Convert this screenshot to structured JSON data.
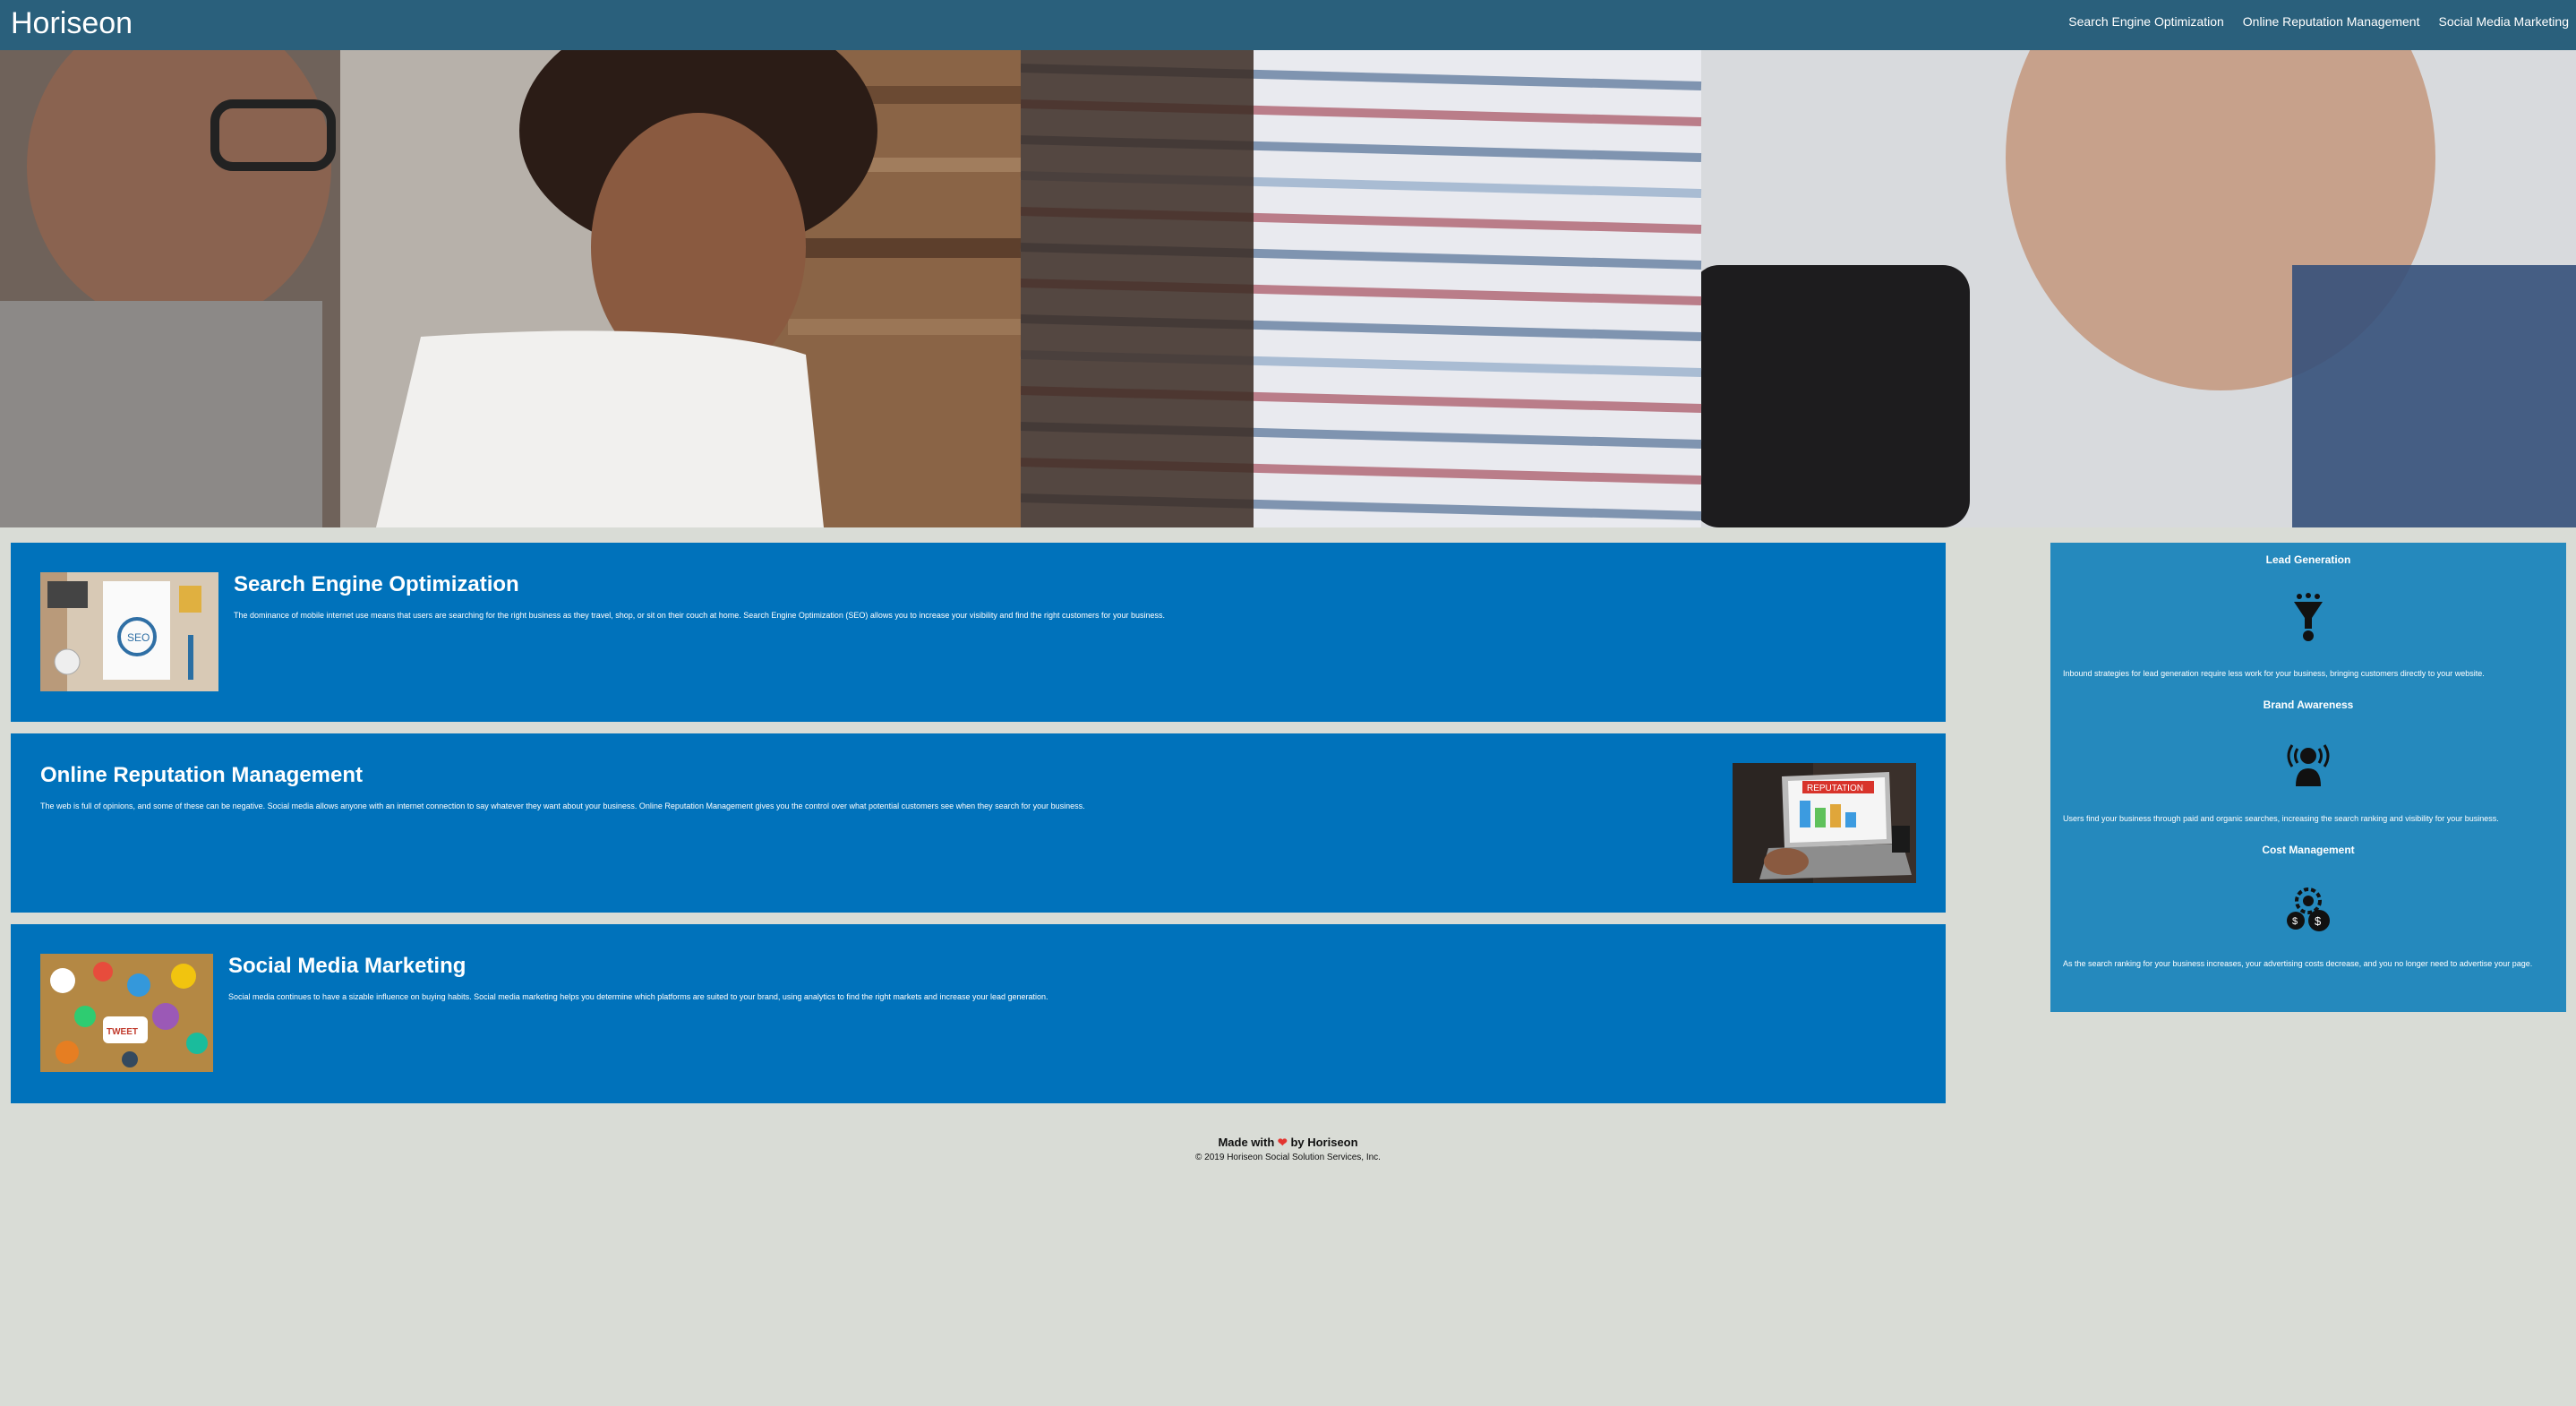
{
  "header": {
    "logo": "Horiseon",
    "nav": [
      {
        "label": "Search Engine Optimization"
      },
      {
        "label": "Online Reputation Management"
      },
      {
        "label": "Social Media Marketing"
      }
    ]
  },
  "content": {
    "cards": [
      {
        "title": "Search Engine Optimization",
        "text": "The dominance of mobile internet use means that users are searching for the right business as they travel, shop, or sit on their couch at home. Search Engine Optimization (SEO) allows you to increase your visibility and find the right customers for your business."
      },
      {
        "title": "Online Reputation Management",
        "text": "The web is full of opinions, and some of these can be negative. Social media allows anyone with an internet connection to say whatever they want about your business. Online Reputation Management gives you the control over what potential customers see when they search for your business."
      },
      {
        "title": "Social Media Marketing",
        "text": "Social media continues to have a sizable influence on buying habits. Social media marketing helps you determine which platforms are suited to your brand, using analytics to find the right markets and increase your lead generation."
      }
    ]
  },
  "sidebar": {
    "items": [
      {
        "title": "Lead Generation",
        "text": "Inbound strategies for lead generation require less work for your business, bringing customers directly to your website."
      },
      {
        "title": "Brand Awareness",
        "text": "Users find your business through paid and organic searches, increasing the search ranking and visibility for your business."
      },
      {
        "title": "Cost Management",
        "text": "As the search ranking for your business increases, your advertising costs decrease, and you no longer need to advertise your page."
      }
    ]
  },
  "footer": {
    "made_prefix": "Made with",
    "made_suffix": "by Horiseon",
    "copyright": "© 2019 Horiseon Social Solution Services, Inc."
  },
  "images": {
    "seo_thumb_text": "SEO",
    "reputation_thumb_text": "REPUTATION",
    "social_thumb_text": "TWEET"
  },
  "colors": {
    "header_bg": "#2a607c",
    "card_bg": "#0072bb",
    "sidebar_bg": "#2589bd",
    "page_bg": "#d9dcd6",
    "heart": "#e3342f"
  }
}
